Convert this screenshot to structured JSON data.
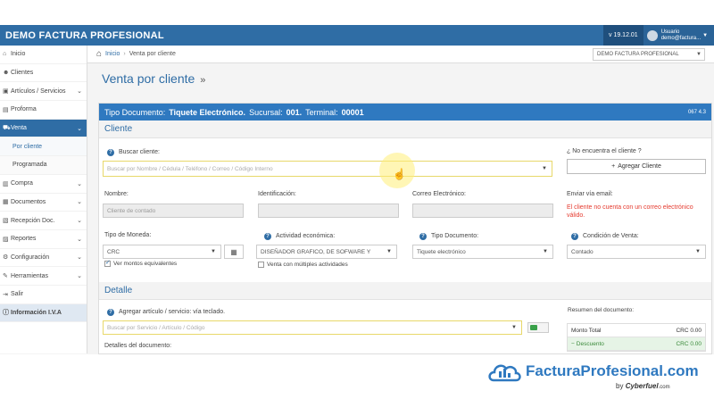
{
  "app": {
    "title": "DEMO FACTURA PROFESIONAL",
    "version": "v 19.12.01",
    "user_label": "Usuario",
    "user_email": "demo@factura..."
  },
  "sidebar": {
    "items": [
      {
        "label": "Inicio",
        "icon": "home-icon"
      },
      {
        "label": "Clientes",
        "icon": "users-icon"
      },
      {
        "label": "Artículos / Servicios",
        "icon": "cube-icon",
        "chevron": true
      },
      {
        "label": "Proforma",
        "icon": "file-icon"
      },
      {
        "label": "Venta",
        "icon": "cart-icon",
        "chevron": true,
        "active": true
      },
      {
        "label": "Por cliente",
        "sub": true,
        "selected": true
      },
      {
        "label": "Programada",
        "sub": true
      },
      {
        "label": "Compra",
        "icon": "bag-icon",
        "chevron": true
      },
      {
        "label": "Documentos",
        "icon": "folder-icon",
        "chevron": true
      },
      {
        "label": "Recepción Doc.",
        "icon": "inbox-icon",
        "chevron": true
      },
      {
        "label": "Reportes",
        "icon": "chart-icon",
        "chevron": true
      },
      {
        "label": "Configuración",
        "icon": "gear-icon",
        "chevron": true
      },
      {
        "label": "Herramientas",
        "icon": "wrench-icon",
        "chevron": true
      },
      {
        "label": "Salir",
        "icon": "logout-icon"
      },
      {
        "label": "Información I.V.A",
        "icon": "info-icon"
      }
    ]
  },
  "breadcrumb": {
    "home": "Inicio",
    "current": "Venta por cliente"
  },
  "company_select": "DEMO FACTURA PROFESIONAL",
  "page_title": "Venta por cliente",
  "document": {
    "header_prefix": "Tipo Documento:",
    "doc_type": "Tiquete Electrónico.",
    "sucursal_label": "Sucursal:",
    "sucursal": "001.",
    "terminal_label": "Terminal:",
    "terminal": "00001",
    "code": "067 4.3"
  },
  "cliente": {
    "section": "Cliente",
    "search_label": "Buscar cliente:",
    "search_placeholder": "Buscar por Nombre / Cédula / Teléfono / Correo / Código Interno",
    "not_found": "¿ No encuentra el cliente ?",
    "add_button": "Agregar Cliente",
    "nombre_label": "Nombre:",
    "nombre_value": "Cliente de contado",
    "identificacion_label": "Identificación:",
    "correo_label": "Correo Electrónico:",
    "enviar_label": "Enviar vía email:",
    "enviar_error": "El cliente no cuenta con un correo electrónico válido.",
    "moneda_label": "Tipo de Moneda:",
    "moneda_value": "CRC",
    "montos_label": "Ver montos equivalentes",
    "actividad_label": "Actividad económica:",
    "actividad_value": "DISEÑADOR GRAFICO, DE SOFWARE Y",
    "multiples_label": "Venta con múltiples actividades",
    "tipo_doc_label": "Tipo Documento:",
    "tipo_doc_value": "Tiquete electrónico",
    "condicion_label": "Condición de Venta:",
    "condicion_value": "Contado"
  },
  "detalle": {
    "section": "Detalle",
    "add_label": "Agregar artículo / servicio: vía teclado.",
    "search_placeholder": "Buscar por Servicio / Artículo / Código",
    "detalles_label": "Detalles del documento:",
    "resumen_label": "Resumen del documento:",
    "monto_total_label": "Monto Total",
    "monto_total_value": "CRC 0.00",
    "descuento_label": "Descuento",
    "descuento_value": "CRC 0.00"
  },
  "logo": {
    "name": "FacturaProfesional.com",
    "by": "by",
    "company": "Cyberfuel",
    "suffix": ".com"
  }
}
